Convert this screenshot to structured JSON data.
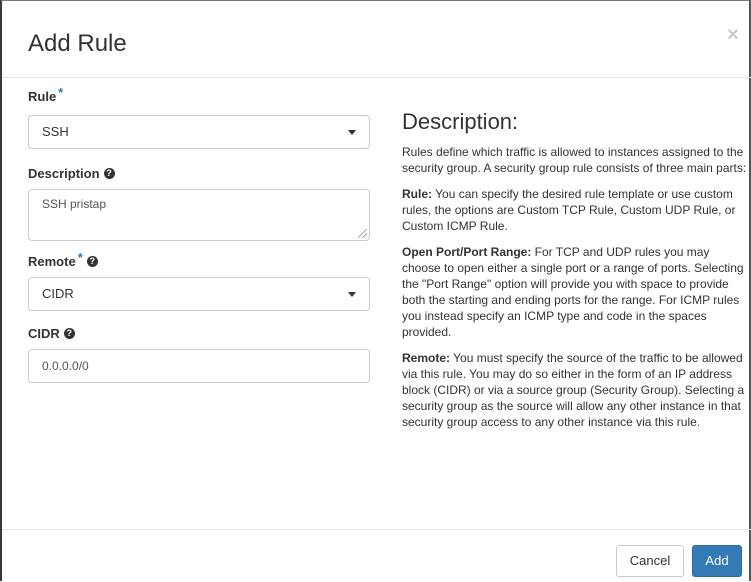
{
  "modal": {
    "title": "Add Rule",
    "close_glyph": "×"
  },
  "form": {
    "rule": {
      "label": "Rule",
      "required_mark": "*",
      "value": "SSH"
    },
    "description": {
      "label": "Description",
      "help_icon": "question-circle-icon",
      "value": "SSH pristap"
    },
    "remote": {
      "label": "Remote",
      "required_mark": "*",
      "help_icon": "question-circle-icon",
      "value": "CIDR"
    },
    "cidr": {
      "label": "CIDR",
      "help_icon": "question-circle-icon",
      "value": "0.0.0.0/0"
    }
  },
  "help": {
    "title": "Description:",
    "intro": "Rules define which traffic is allowed to instances assigned to the security group. A security group rule consists of three main parts:",
    "rule_heading": "Rule:",
    "rule_text": " You can specify the desired rule template or use custom rules, the options are Custom TCP Rule, Custom UDP Rule, or Custom ICMP Rule.",
    "port_heading": "Open Port/Port Range:",
    "port_text": " For TCP and UDP rules you may choose to open either a single port or a range of ports. Selecting the \"Port Range\" option will provide you with space to provide both the starting and ending ports for the range. For ICMP rules you instead specify an ICMP type and code in the spaces provided.",
    "remote_heading": "Remote:",
    "remote_text": " You must specify the source of the traffic to be allowed via this rule. You may do so either in the form of an IP address block (CIDR) or via a source group (Security Group). Selecting a security group as the source will allow any other instance in that security group access to any other instance via this rule."
  },
  "footer": {
    "cancel_label": "Cancel",
    "add_label": "Add"
  },
  "colors": {
    "primary": "#337ab7",
    "required": "#337ab7",
    "border": "#cccccc"
  }
}
